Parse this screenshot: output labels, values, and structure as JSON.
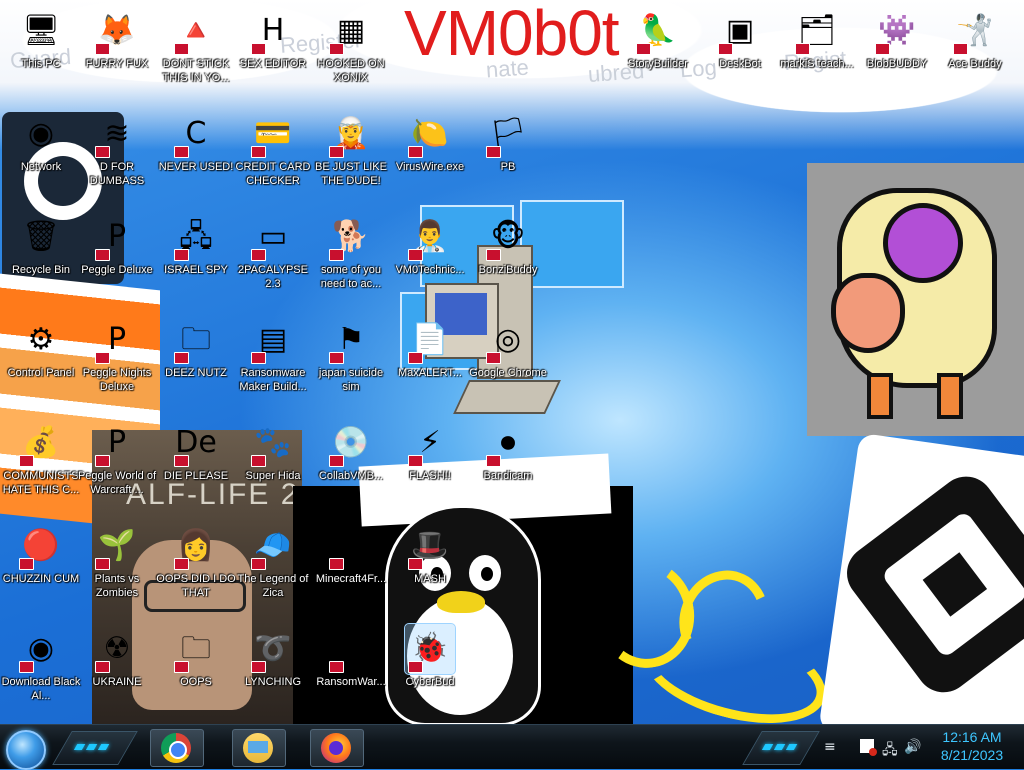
{
  "wallpaper": {
    "title": "VM0b0t",
    "ghost_words": [
      "Guard",
      "Register",
      "nate",
      "ubred",
      "Log",
      "Regist"
    ],
    "hl2_text": "ALF-LIFE 2"
  },
  "desktop": {
    "icons": [
      {
        "label": "This PC",
        "icon": "monitor-icon",
        "glyph": "🖥"
      },
      {
        "label": "FURRY FUX",
        "icon": "firefox-icon",
        "glyph": "🦊"
      },
      {
        "label": "DONT STICK THIS IN YO...",
        "icon": "traffic-cone-icon",
        "glyph": "🔺"
      },
      {
        "label": "SEX EDITOR",
        "icon": "hxd-icon",
        "glyph": "H"
      },
      {
        "label": "HOOKED ON XONIX",
        "icon": "xonix-icon",
        "glyph": "▦"
      },
      {
        "label": "StoryBuilder",
        "icon": "green-parrot-icon",
        "glyph": "🦜"
      },
      {
        "label": "DeskBot",
        "icon": "deskbot-icon",
        "glyph": "▣"
      },
      {
        "label": "markiS teach...",
        "icon": "window-stack-icon",
        "glyph": "🗂"
      },
      {
        "label": "BlobBUDDY",
        "icon": "purple-blob-icon",
        "glyph": "👾"
      },
      {
        "label": "Ace Buddy",
        "icon": "fencer-icon",
        "glyph": "🤺"
      },
      {
        "label": "Network",
        "icon": "network-orb-icon",
        "glyph": "◉"
      },
      {
        "label": "D FOR DUMBASS",
        "icon": "spotify-icon",
        "glyph": "≋"
      },
      {
        "label": "NEVER USED!",
        "icon": "devcpp-icon",
        "glyph": "C"
      },
      {
        "label": "CREDIT CARD CHECKER",
        "icon": "credit-card-icon",
        "glyph": "💳"
      },
      {
        "label": "BE JUST LIKE THE DUDE!",
        "icon": "elf-icon",
        "glyph": "🧝"
      },
      {
        "label": "VirusWire.exe",
        "icon": "lime-icon",
        "glyph": "🍋"
      },
      {
        "label": "PB",
        "icon": "flag-file-icon",
        "glyph": "🏳"
      },
      {
        "label": "Recycle Bin",
        "icon": "recycle-bin-icon",
        "glyph": "🗑"
      },
      {
        "label": "Peggle Deluxe",
        "icon": "peggle-icon",
        "glyph": "P"
      },
      {
        "label": "ISRAEL SPY",
        "icon": "network-pc-icon",
        "glyph": "🖧"
      },
      {
        "label": "2PACALYPSE 2.3",
        "icon": "terminal-icon",
        "glyph": "▭"
      },
      {
        "label": "some of you need to ac...",
        "icon": "dog-icon",
        "glyph": "🐕"
      },
      {
        "label": "VM0Technic...",
        "icon": "doctor-icon",
        "glyph": "👨‍⚕"
      },
      {
        "label": "BonziBuddy",
        "icon": "bonzi-icon",
        "glyph": "🐵"
      },
      {
        "label": "Control Panel",
        "icon": "control-panel-icon",
        "glyph": "⚙"
      },
      {
        "label": "Peggle Nights Deluxe",
        "icon": "peggle-nights-icon",
        "glyph": "P"
      },
      {
        "label": "DEEZ NUTZ",
        "icon": "folders-icon",
        "glyph": "🗀"
      },
      {
        "label": "Ransomware Maker Build...",
        "icon": "app-window-icon",
        "glyph": "▤"
      },
      {
        "label": "japan suicide sim",
        "icon": "sim-icon",
        "glyph": "⚑"
      },
      {
        "label": "MaxALERT...",
        "icon": "docs-icon",
        "glyph": "📄"
      },
      {
        "label": "Google Chrome",
        "icon": "chrome-icon",
        "glyph": "◎"
      },
      {
        "label": "COMMUNISTS HATE THIS C...",
        "icon": "money-bag-icon",
        "glyph": "💰"
      },
      {
        "label": "Peggle World of Warcraft ...",
        "icon": "peggle-wow-icon",
        "glyph": "P"
      },
      {
        "label": "DIE PLEASE",
        "icon": "de-icon",
        "glyph": "De"
      },
      {
        "label": "Super Hida",
        "icon": "pixel-dog-icon",
        "glyph": "🐾"
      },
      {
        "label": "CollabVMB...",
        "icon": "cd-icon",
        "glyph": "💿"
      },
      {
        "label": "FLASH!!",
        "icon": "flash-icon",
        "glyph": "⚡"
      },
      {
        "label": "Bandicam",
        "icon": "record-icon",
        "glyph": "⏺"
      },
      {
        "label": "CHUZZIN CUM",
        "icon": "chuzzle-icon",
        "glyph": "🔴"
      },
      {
        "label": "Plants vs Zombies",
        "icon": "plant-icon",
        "glyph": "🌱"
      },
      {
        "label": "OOPS DID I DO THAT",
        "icon": "portrait-icon",
        "glyph": "👩"
      },
      {
        "label": "The Legend of Zica",
        "icon": "pixel-hero-icon",
        "glyph": "🧢"
      },
      {
        "label": "Minecraft4Fr...",
        "icon": "grass-block-icon",
        "glyph": "▩"
      },
      {
        "label": "MASH",
        "icon": "hat-icon",
        "glyph": "🎩"
      },
      {
        "label": "Download Black Al...",
        "icon": "red-orb-icon",
        "glyph": "◉"
      },
      {
        "label": "UKRAINE",
        "icon": "radiation-icon",
        "glyph": "☢"
      },
      {
        "label": "OOPS",
        "icon": "folder-stack-icon",
        "glyph": "🗀"
      },
      {
        "label": "LYNCHING",
        "icon": "noose-icon",
        "glyph": "➰"
      },
      {
        "label": "RansomWar...",
        "icon": "skull-icon",
        "glyph": "☠"
      },
      {
        "label": "CyberBud",
        "icon": "cyberbud-icon",
        "glyph": "🐞"
      }
    ]
  },
  "taskbar": {
    "pinned": [
      {
        "name": "chrome",
        "icon": "chrome-icon"
      },
      {
        "name": "file-explorer",
        "icon": "folder-icon"
      },
      {
        "name": "firefox",
        "icon": "firefox-icon"
      }
    ],
    "tray": {
      "flag": "action-center-icon",
      "network": "network-icon",
      "volume": "volume-icon"
    },
    "clock": {
      "time": "12:16 AM",
      "date": "8/21/2023"
    }
  },
  "colors": {
    "title_red": "#e11d1d",
    "clock_cyan": "#3ec6ff",
    "badge_red": "#c8102e"
  }
}
